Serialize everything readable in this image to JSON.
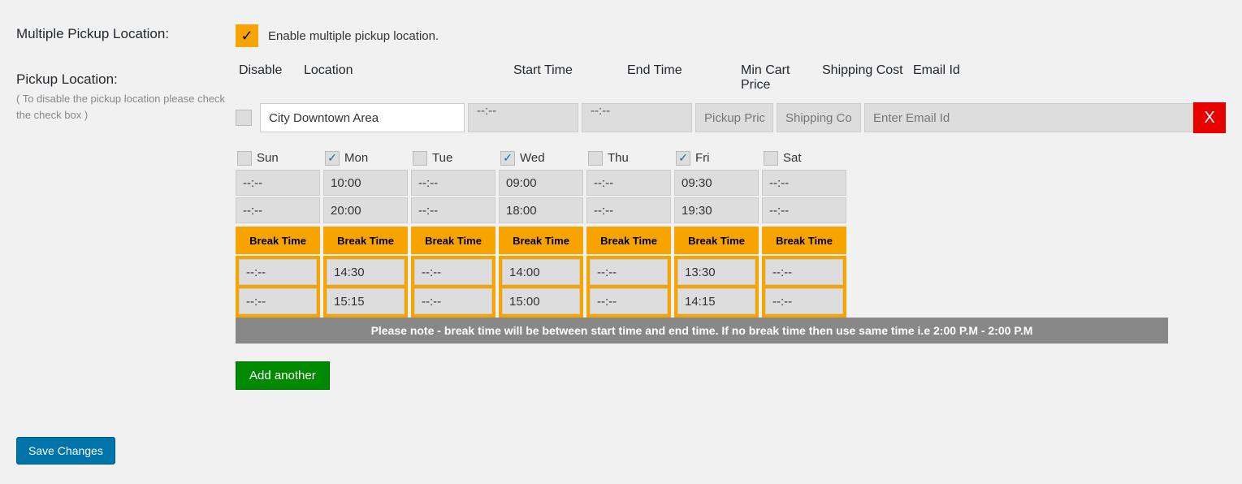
{
  "labels": {
    "multiple_pickup": "Multiple Pickup Location:",
    "enable_text": "Enable multiple pickup location.",
    "pickup_location": "Pickup Location:",
    "pickup_sub": "( To disable the pickup location please check the check box )"
  },
  "headers": {
    "disable": "Disable",
    "location": "Location",
    "start": "Start Time",
    "end": "End Time",
    "mincart": "Min Cart Price",
    "ship": "Shipping Cost",
    "email": "Email Id"
  },
  "location_row": {
    "location_value": "City Downtown Area",
    "start_value": "--:--",
    "end_value": "--:--",
    "mincart_placeholder": "Pickup Price",
    "ship_placeholder": "Shipping Cost",
    "email_placeholder": "Enter Email Id",
    "delete_label": "X"
  },
  "days": [
    {
      "name": "Sun",
      "checked": false,
      "start": "--:--",
      "end": "--:--",
      "break_start": "--:--",
      "break_end": "--:--"
    },
    {
      "name": "Mon",
      "checked": true,
      "start": "10:00",
      "end": "20:00",
      "break_start": "14:30",
      "break_end": "15:15"
    },
    {
      "name": "Tue",
      "checked": false,
      "start": "--:--",
      "end": "--:--",
      "break_start": "--:--",
      "break_end": "--:--"
    },
    {
      "name": "Wed",
      "checked": true,
      "start": "09:00",
      "end": "18:00",
      "break_start": "14:00",
      "break_end": "15:00"
    },
    {
      "name": "Thu",
      "checked": false,
      "start": "--:--",
      "end": "--:--",
      "break_start": "--:--",
      "break_end": "--:--"
    },
    {
      "name": "Fri",
      "checked": true,
      "start": "09:30",
      "end": "19:30",
      "break_start": "13:30",
      "break_end": "14:15"
    },
    {
      "name": "Sat",
      "checked": false,
      "start": "--:--",
      "end": "--:--",
      "break_start": "--:--",
      "break_end": "--:--"
    }
  ],
  "break_label": "Break Time",
  "note": "Please note - break time will be between start time and end time. If no break time then use same time i.e 2:00 P.M - 2:00 P.M",
  "buttons": {
    "add": "Add another",
    "save": "Save Changes"
  }
}
